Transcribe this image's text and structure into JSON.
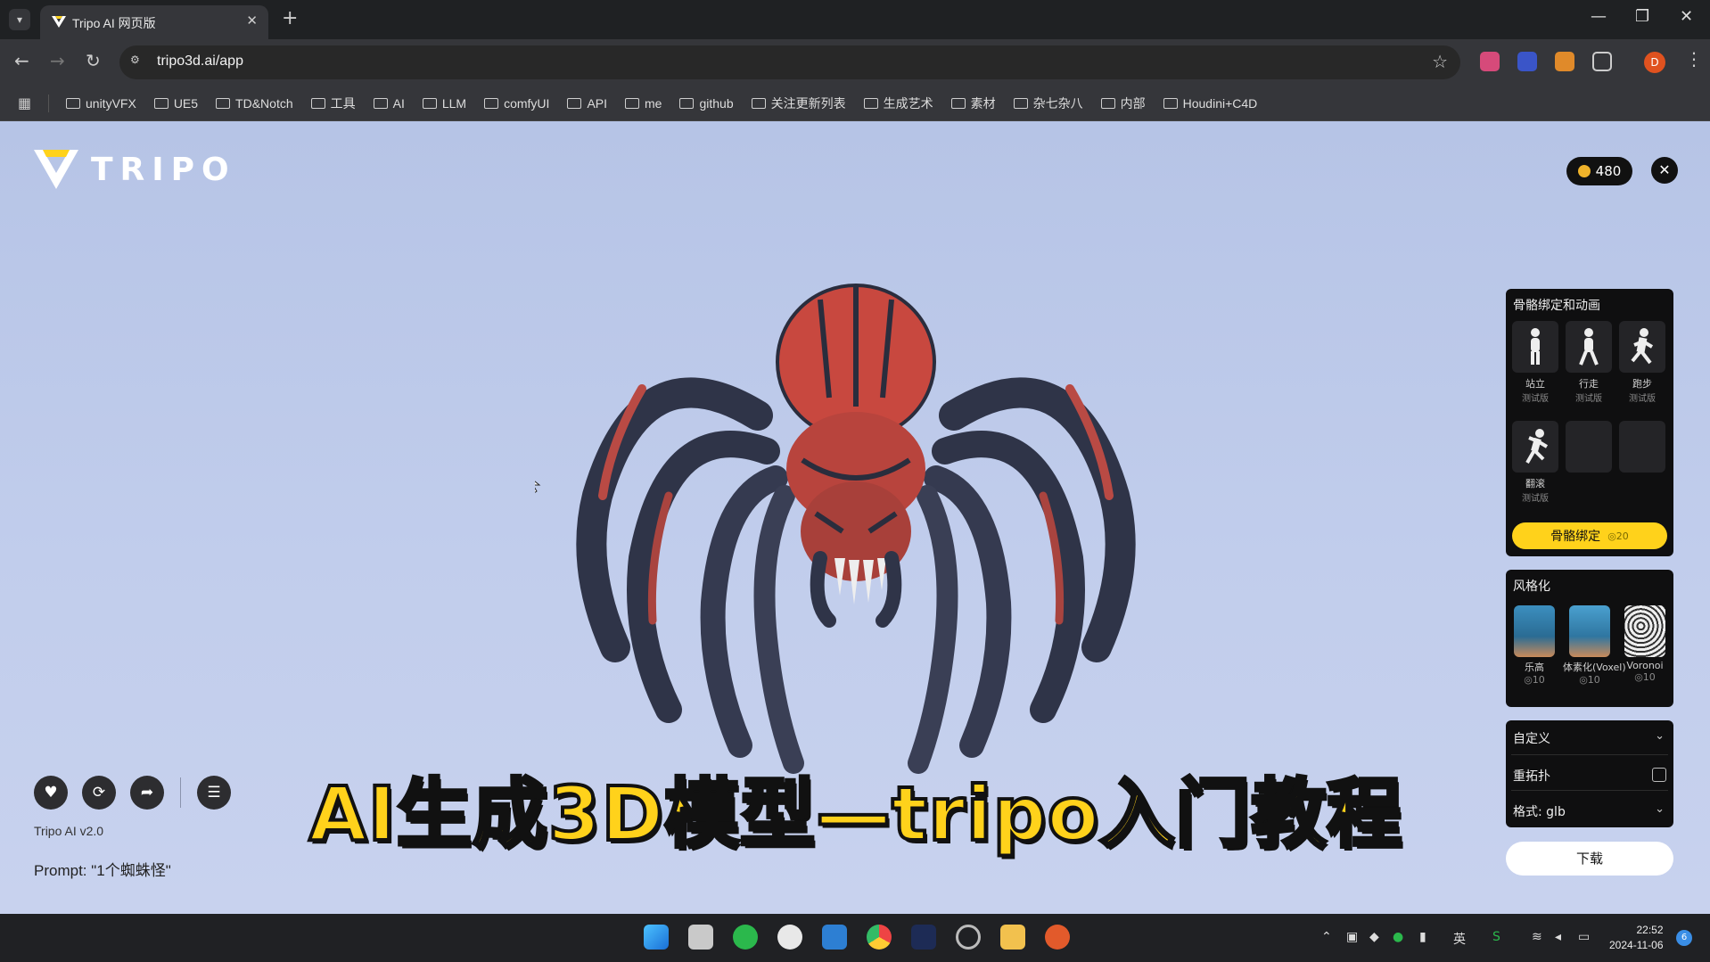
{
  "browser": {
    "tab_title": "Tripo AI 网页版",
    "url": "tripo3d.ai/app",
    "profile_initial": "D",
    "bookmarks": [
      "unityVFX",
      "UE5",
      "TD&Notch",
      "工具",
      "AI",
      "LLM",
      "comfyUI",
      "API",
      "me",
      "github",
      "关注更新列表",
      "生成艺术",
      "素材",
      "杂七杂八",
      "内部",
      "Houdini+C4D"
    ]
  },
  "app": {
    "logo_text": "TRIPO",
    "credits": "480",
    "version": "Tripo AI v2.0",
    "prompt": "Prompt: \"1个蜘蛛怪\"",
    "overlay_title": "AI生成3D模型—tripo入门教程",
    "accent_color": "#ffd21b"
  },
  "rigging": {
    "title": "骨骼绑定和动画",
    "animations": [
      {
        "label": "站立",
        "sub": "测试版"
      },
      {
        "label": "行走",
        "sub": "测试版"
      },
      {
        "label": "跑步",
        "sub": "测试版"
      },
      {
        "label": "翻滚",
        "sub": "测试版"
      }
    ],
    "button_label": "骨骼绑定",
    "button_cost": "◎20"
  },
  "stylize": {
    "title": "风格化",
    "styles": [
      {
        "label": "乐高",
        "cost": "◎10"
      },
      {
        "label": "体素化(Voxel)",
        "cost": "◎10"
      },
      {
        "label": "Voronoi",
        "cost": "◎10"
      }
    ]
  },
  "custom": {
    "title": "自定义",
    "retopo_label": "重拓扑",
    "format_label": "格式: glb"
  },
  "download_label": "下载",
  "taskbar": {
    "time": "22:52",
    "date": "2024-11-06",
    "ime": "英",
    "notifications": "6"
  }
}
